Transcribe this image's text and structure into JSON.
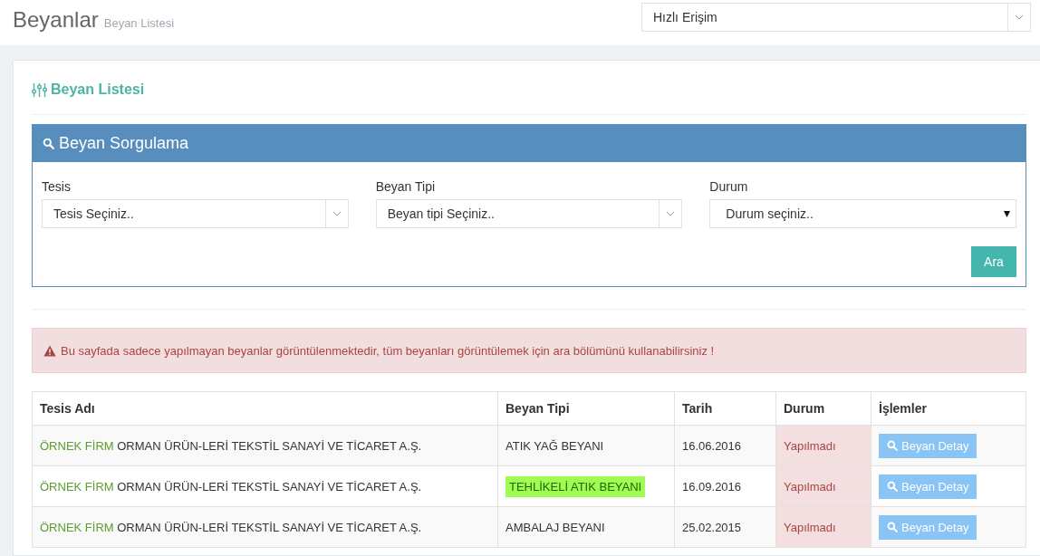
{
  "header": {
    "title": "Beyanlar",
    "subtitle": "Beyan Listesi",
    "quick_access": {
      "placeholder": "Hızlı Erişim"
    }
  },
  "panel": {
    "title": "Beyan Listesi"
  },
  "search": {
    "title": "Beyan Sorgulama",
    "fields": [
      {
        "label": "Tesis",
        "kind": "select2",
        "placeholder": "Tesis Seçiniz.."
      },
      {
        "label": "Beyan Tipi",
        "kind": "select2",
        "placeholder": "Beyan tipi Seçiniz.."
      },
      {
        "label": "Durum",
        "kind": "native",
        "placeholder": "Durum seçiniz.."
      }
    ],
    "button": "Ara"
  },
  "alert": "Bu sayfada sadece yapılmayan beyanlar görüntülenmektedir, tüm beyanları görüntülemek için ara bölümünü kullanabilirsiniz !",
  "table": {
    "columns": [
      "Tesis Adı",
      "Beyan Tipi",
      "Tarih",
      "Durum",
      "İşlemler"
    ],
    "rows": [
      {
        "firm": "ÖRNEK FİRM",
        "facility": "ORMAN ÜRÜN-LERİ TEKSTİL SANAYİ VE TİCARET A.Ş.",
        "type": "ATIK YAĞ BEYANI",
        "highlighted": false,
        "date": "16.06.2016",
        "status": "Yapılmadı",
        "action": "Beyan Detay"
      },
      {
        "firm": "ÖRNEK FİRM",
        "facility": "ORMAN ÜRÜN-LERİ TEKSTİL SANAYİ VE TİCARET A.Ş.",
        "type": "TEHLİKELİ ATIK BEYANI",
        "highlighted": true,
        "date": "16.09.2016",
        "status": "Yapılmadı",
        "action": "Beyan Detay"
      },
      {
        "firm": "ÖRNEK FİRM",
        "facility": "ORMAN ÜRÜN-LERİ TEKSTİL SANAYİ VE TİCARET A.Ş.",
        "type": "AMBALAJ BEYANI",
        "highlighted": false,
        "date": "25.02.2015",
        "status": "Yapılmadı",
        "action": "Beyan Detay"
      }
    ]
  }
}
